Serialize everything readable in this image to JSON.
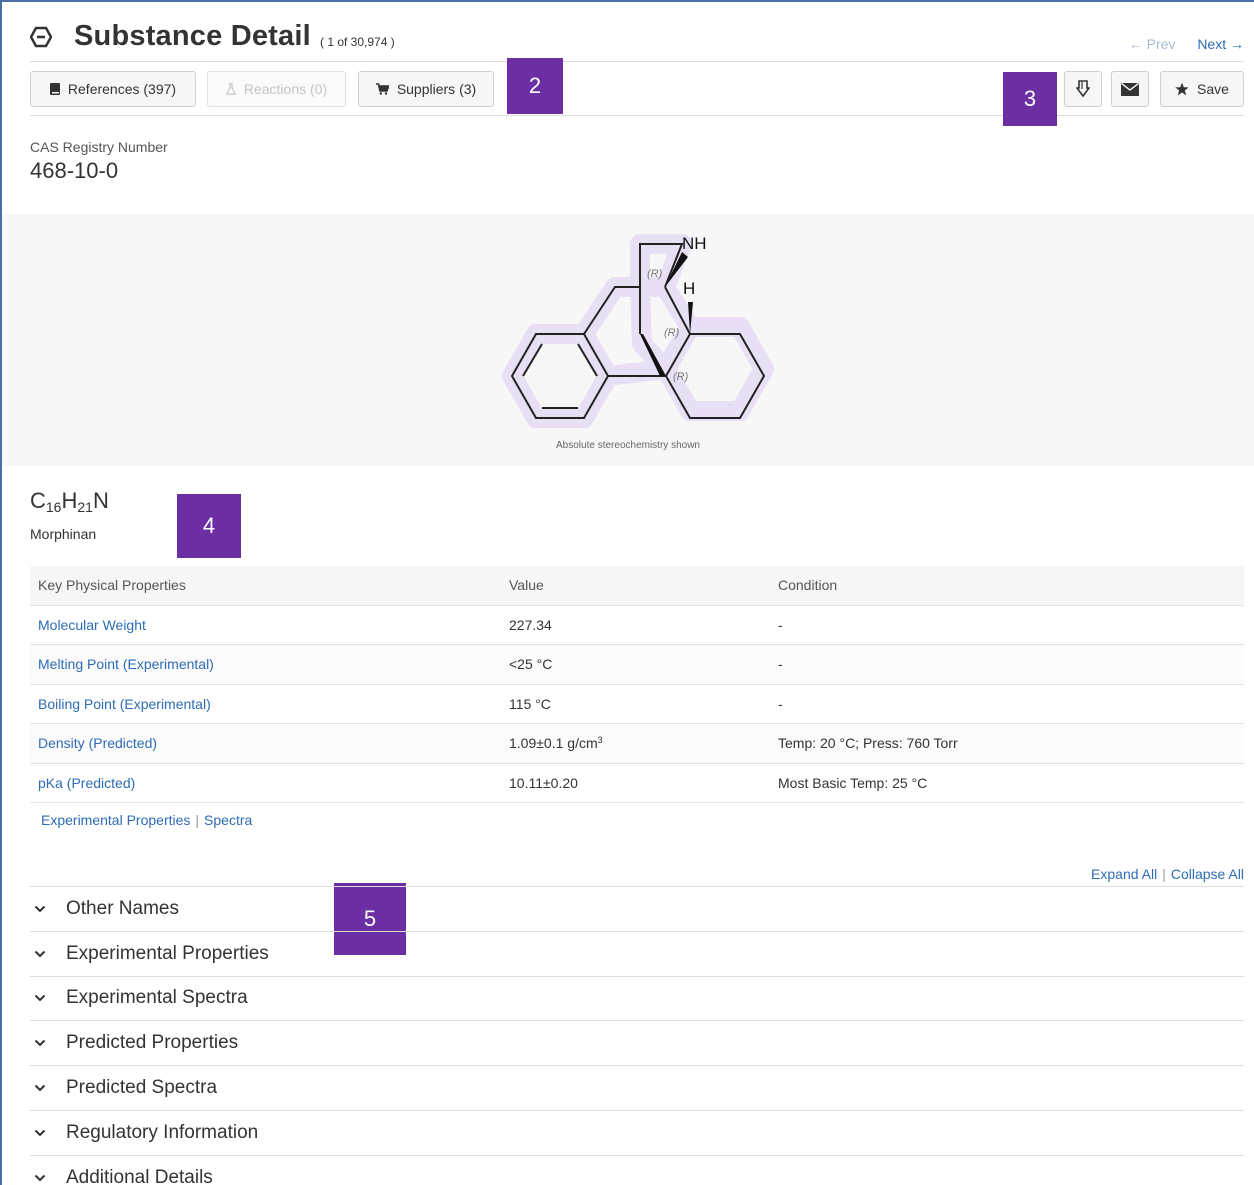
{
  "header": {
    "title": "Substance Detail",
    "count": "( 1 of 30,974 )",
    "prev_label": "← Prev",
    "next_label": "Next →"
  },
  "toolbar": {
    "references_label": "References (397)",
    "reactions_label": "Reactions (0)",
    "suppliers_label": "Suppliers (3)",
    "save_label": "Save"
  },
  "callouts": [
    "2",
    "3",
    "4",
    "5"
  ],
  "substance": {
    "cas_label": "CAS Registry Number",
    "cas_number": "468-10-0",
    "stereo_note": "Absolute stereochemistry shown",
    "formula_parts": [
      "C",
      "16",
      "H",
      "21",
      "N"
    ],
    "name": "Morphinan",
    "structure_labels": {
      "nh": "NH",
      "h": "H",
      "r1": "(R)",
      "r2": "(R)",
      "r3": "(R)"
    }
  },
  "properties": {
    "headers": [
      "Key Physical Properties",
      "Value",
      "Condition"
    ],
    "rows": [
      {
        "name": "Molecular Weight",
        "value": "227.34",
        "condition": "-"
      },
      {
        "name": "Melting Point (Experimental)",
        "value": "<25 °C",
        "condition": "-"
      },
      {
        "name": "Boiling Point (Experimental)",
        "value": "115 °C",
        "condition": "-"
      },
      {
        "name": "Density (Predicted)",
        "value": "1.09±0.1 g/cm",
        "value_sup": "3",
        "condition": "Temp: 20 °C; Press: 760 Torr"
      },
      {
        "name": "pKa (Predicted)",
        "value": "10.11±0.20",
        "condition": "Most Basic Temp: 25 °C"
      }
    ],
    "links": [
      "Experimental Properties",
      "Spectra"
    ]
  },
  "expand": {
    "expand_all": "Expand All",
    "collapse_all": "Collapse All"
  },
  "sections": [
    "Other Names",
    "Experimental Properties",
    "Experimental Spectra",
    "Predicted Properties",
    "Predicted Spectra",
    "Regulatory Information",
    "Additional Details"
  ],
  "colors": {
    "link": "#2d6cb5",
    "callout": "#6b2ea3",
    "highlight": "#e8dff5"
  },
  "icons": [
    "substance-hexagon-icon",
    "book-icon",
    "flask-icon",
    "cart-icon",
    "download-icon",
    "envelope-icon",
    "star-icon",
    "chevron-down-icon"
  ]
}
